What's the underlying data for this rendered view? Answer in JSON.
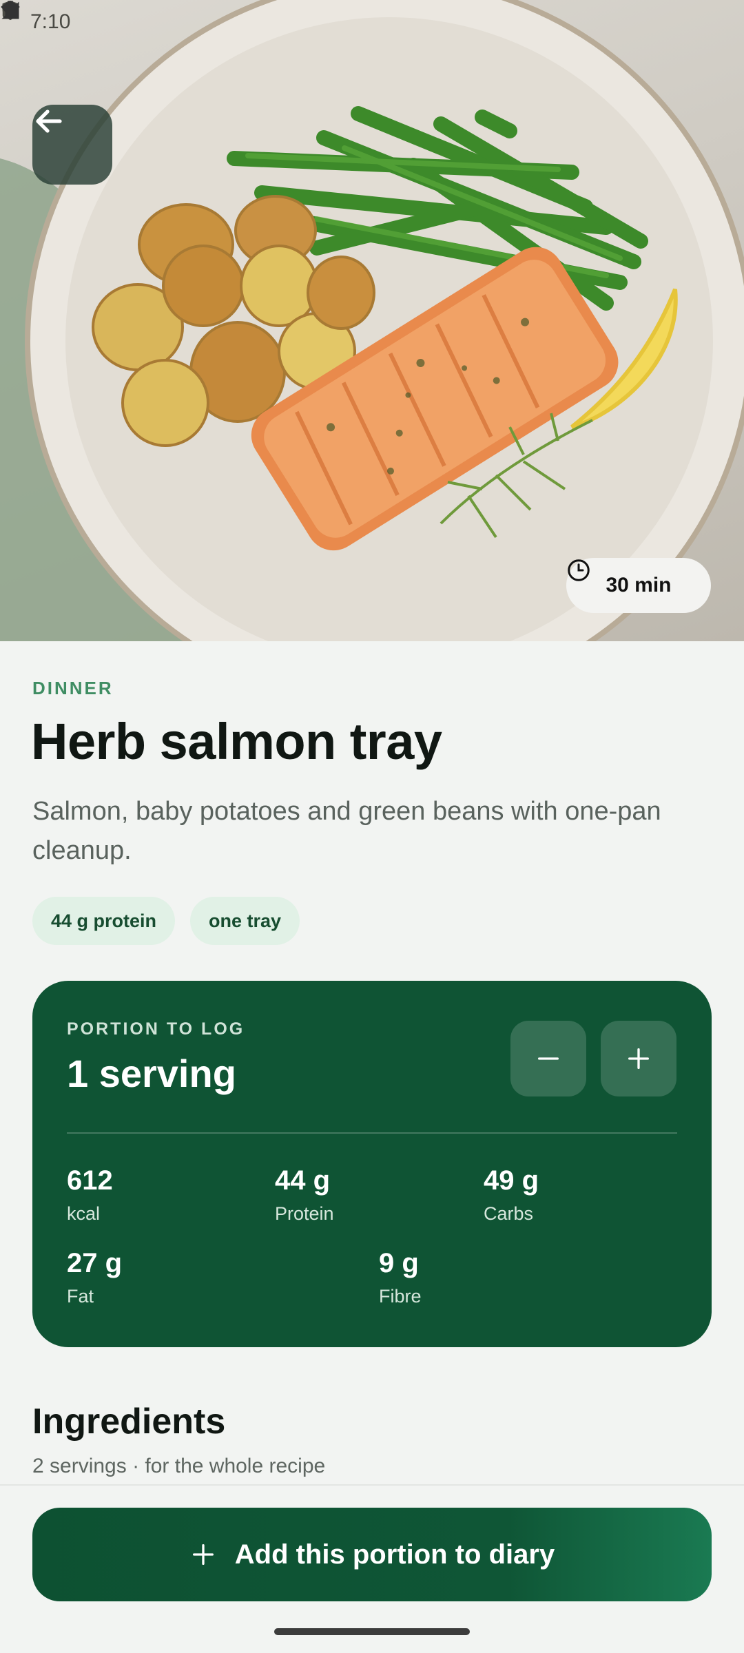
{
  "status_bar": {
    "time": "7:10"
  },
  "hero": {
    "time_chip": "30 min"
  },
  "recipe": {
    "category": "DINNER",
    "title": "Herb salmon tray",
    "description": "Salmon, baby potatoes and green beans with one-pan cleanup.",
    "tags": [
      "44 g protein",
      "one tray"
    ]
  },
  "portion": {
    "label": "PORTION TO LOG",
    "value": "1 serving",
    "nutrition": [
      {
        "value": "612",
        "label": "kcal"
      },
      {
        "value": "44 g",
        "label": "Protein"
      },
      {
        "value": "49 g",
        "label": "Carbs"
      },
      {
        "value": "27 g",
        "label": "Fat"
      },
      {
        "value": "9 g",
        "label": "Fibre"
      }
    ]
  },
  "ingredients": {
    "title": "Ingredients",
    "subtitle": "2 servings · for the whole recipe"
  },
  "cta": {
    "label": "Add this portion to diary"
  },
  "colors": {
    "primary": "#0f5434",
    "accent": "#3f8d63",
    "tag_bg": "#e1f1e6",
    "background": "#f2f4f2"
  },
  "icons": [
    "back-arrow-icon",
    "clock-icon",
    "minus-icon",
    "plus-icon"
  ]
}
